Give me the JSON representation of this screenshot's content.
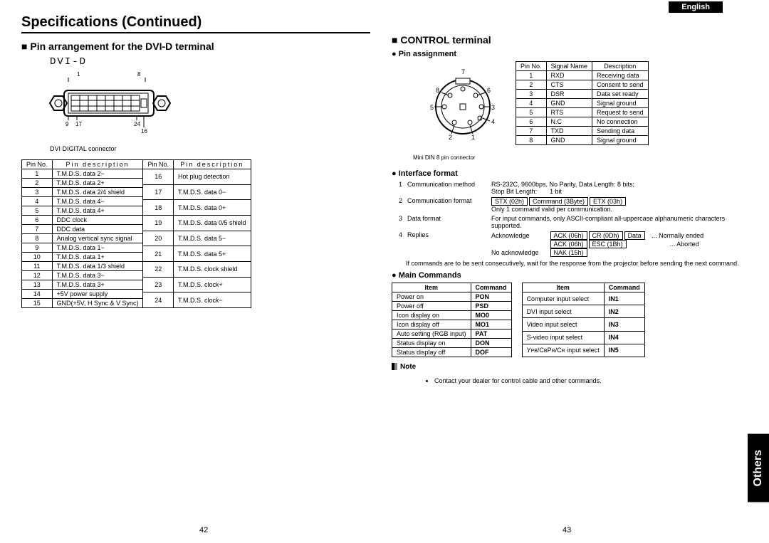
{
  "header": {
    "title": "Specifications (Continued)",
    "language": "English"
  },
  "left": {
    "heading": "Pin arrangement for the DVI-D terminal",
    "dvi_label": "DVI-D",
    "connector_caption": "DVI DIGITAL connector",
    "table1": {
      "cols": [
        "Pin No.",
        "Pin description"
      ],
      "rows": [
        [
          "1",
          "T.M.D.S. data 2−"
        ],
        [
          "2",
          "T.M.D.S. data 2+"
        ],
        [
          "3",
          "T.M.D.S. data 2/4 shield"
        ],
        [
          "4",
          "T.M.D.S. data 4−"
        ],
        [
          "5",
          "T.M.D.S. data 4+"
        ],
        [
          "6",
          "DDC clock"
        ],
        [
          "7",
          "DDC data"
        ],
        [
          "8",
          "Analog vertical sync signal"
        ],
        [
          "9",
          "T.M.D.S. data 1−"
        ],
        [
          "10",
          "T.M.D.S. data 1+"
        ],
        [
          "11",
          "T.M.D.S. data 1/3 shield"
        ],
        [
          "12",
          "T.M.D.S. data 3−"
        ],
        [
          "13",
          "T.M.D.S. data 3+"
        ],
        [
          "14",
          "+5V power supply"
        ],
        [
          "15",
          "GND(+5V, H Sync & V Sync)"
        ]
      ]
    },
    "table2": {
      "cols": [
        "Pin No.",
        "Pin description"
      ],
      "rows": [
        [
          "16",
          "Hot plug detection"
        ],
        [
          "17",
          "T.M.D.S. data 0−"
        ],
        [
          "18",
          "T.M.D.S. data 0+"
        ],
        [
          "19",
          "T.M.D.S. data 0/5 shield"
        ],
        [
          "20",
          "T.M.D.S. data 5−"
        ],
        [
          "21",
          "T.M.D.S. data 5+"
        ],
        [
          "22",
          "T.M.D.S. clock shield"
        ],
        [
          "23",
          "T.M.D.S. clock+"
        ],
        [
          "24",
          "T.M.D.S. clock−"
        ]
      ]
    }
  },
  "right": {
    "heading": "CONTROL terminal",
    "pin_assignment_label": "Pin assignment",
    "connector_caption": "Mini DIN 8 pin connector",
    "pin_table": {
      "cols": [
        "Pin No.",
        "Signal Name",
        "Description"
      ],
      "rows": [
        [
          "1",
          "RXD",
          "Receiving data"
        ],
        [
          "2",
          "CTS",
          "Consent to send"
        ],
        [
          "3",
          "DSR",
          "Data set ready"
        ],
        [
          "4",
          "GND",
          "Signal ground"
        ],
        [
          "5",
          "RTS",
          "Request to send"
        ],
        [
          "6",
          "N.C",
          "No connection"
        ],
        [
          "7",
          "TXD",
          "Sending data"
        ],
        [
          "8",
          "GND",
          "Signal ground"
        ]
      ]
    },
    "iface_label": "Interface format",
    "iface": {
      "r1n": "1",
      "r1l": "Communication method",
      "r1v": "RS-232C, 9600bps, No Parity, Data Length: 8 bits;",
      "r1v2": "Stop Bit Length:  1 bit",
      "r2n": "2",
      "r2l": "Communication format",
      "r2b1": "STX (02h)",
      "r2b2": "Command (3Byte)",
      "r2b3": "ETX (03h)",
      "r2v2": "Only 1 command valid per communication.",
      "r3n": "3",
      "r3l": "Data format",
      "r3v": "For input commands, only ASCII-compliant all-uppercase alphanumeric characters supported.",
      "r4n": "4",
      "r4l": "Replies",
      "r4ack": "Acknowledge",
      "r4b1": "ACK (06h)",
      "r4b2": "CR (0Dh)",
      "r4b3": "Data",
      "r4s1": "... Normally ended",
      "r4b4": "ACK (06h)",
      "r4b5": "ESC (1Bh)",
      "r4s2": "... Aborted",
      "r4nack": "No acknowledge",
      "r4b6": "NAK (15h)"
    },
    "iface_note": "If commands are to be sent consecutively, wait for the response from the projector before sending the next command.",
    "main_cmd_label": "Main Commands",
    "cmd1": {
      "cols": [
        "Item",
        "Command"
      ],
      "rows": [
        [
          "Power on",
          "PON"
        ],
        [
          "Power off",
          "PSD"
        ],
        [
          "Icon display on",
          "MO0"
        ],
        [
          "Icon display off",
          "MO1"
        ],
        [
          "Auto setting (RGB input)",
          "PAT"
        ],
        [
          "Status display on",
          "DON"
        ],
        [
          "Status display off",
          "DOF"
        ]
      ]
    },
    "cmd2": {
      "cols": [
        "Item",
        "Command"
      ],
      "rows": [
        [
          "Computer input select",
          "IN1"
        ],
        [
          "DVI input select",
          "IN2"
        ],
        [
          "Video input select",
          "IN3"
        ],
        [
          "S-video input select",
          "IN4"
        ],
        [
          "YPB/CBPR/CR input select",
          "IN5"
        ]
      ]
    },
    "note_label": "Note",
    "note_text": "Contact your dealer for control cable and other commands."
  },
  "side_tab": "Others",
  "page_left": "42",
  "page_right": "43"
}
